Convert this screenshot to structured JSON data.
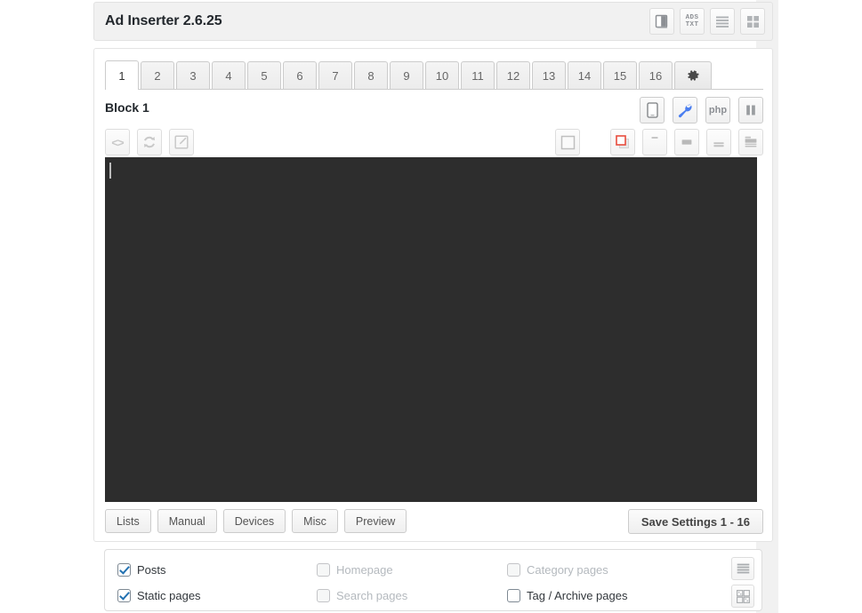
{
  "header": {
    "title": "Ad Inserter 2.6.25",
    "icons": [
      {
        "name": "book-icon",
        "label": "Documentation"
      },
      {
        "name": "ads-txt-icon",
        "label": "ADS TXT"
      },
      {
        "name": "list-view-icon",
        "label": "List"
      },
      {
        "name": "grid-view-icon",
        "label": "Grid"
      }
    ],
    "ads_txt_line1": "ADS",
    "ads_txt_line2": "TXT"
  },
  "tabs": {
    "items": [
      "1",
      "2",
      "3",
      "4",
      "5",
      "6",
      "7",
      "8",
      "9",
      "10",
      "11",
      "12",
      "13",
      "14",
      "15",
      "16"
    ],
    "active_index": 0,
    "settings_tab": {
      "name": "gear-icon",
      "label": "⚙"
    }
  },
  "block": {
    "title": "Block 1",
    "right_icons": [
      {
        "name": "device-icon",
        "label": "Device detection"
      },
      {
        "name": "wrench-icon",
        "label": "Block settings"
      },
      {
        "name": "php-icon",
        "label": "php"
      },
      {
        "name": "pause-icon",
        "label": "Pause"
      }
    ]
  },
  "toolbar": {
    "left_icons": [
      {
        "name": "code-icon",
        "label": "<>"
      },
      {
        "name": "refresh-icon",
        "label": "Reload"
      },
      {
        "name": "edit-icon",
        "label": "Edit"
      }
    ],
    "right_icons": [
      {
        "name": "no-wrapping-icon",
        "label": "No wrapping"
      },
      {
        "name": "clearfix-icon",
        "label": "Clearfix",
        "active": true
      },
      {
        "name": "align-top-icon",
        "label": "Align top"
      },
      {
        "name": "align-center-icon",
        "label": "Align center"
      },
      {
        "name": "align-bottom-icon",
        "label": "Align bottom"
      },
      {
        "name": "align-left-icon",
        "label": "Float left"
      }
    ]
  },
  "editor": {
    "value": "",
    "placeholder": ""
  },
  "buttons": {
    "tabs": [
      "Lists",
      "Manual",
      "Devices",
      "Misc",
      "Preview"
    ],
    "save": "Save Settings 1 - 16"
  },
  "display_options": {
    "items": [
      {
        "label": "Posts",
        "checked": true,
        "disabled": false
      },
      {
        "label": "Homepage",
        "checked": false,
        "disabled": true
      },
      {
        "label": "Category pages",
        "checked": false,
        "disabled": true
      },
      {
        "label": "Static pages",
        "checked": true,
        "disabled": false
      },
      {
        "label": "Search pages",
        "checked": false,
        "disabled": true
      },
      {
        "label": "Tag / Archive pages",
        "checked": false,
        "disabled": false
      }
    ],
    "side_icons": [
      {
        "name": "list-settings-icon",
        "label": "List view"
      },
      {
        "name": "grid-settings-icon",
        "label": "Grid view"
      }
    ]
  },
  "colors": {
    "accent_blue": "#2271b1",
    "wrench_blue": "#4a7ef0",
    "clearfix_red": "#e84c3d",
    "editor_bg": "#2d2d2d",
    "panel_bg": "#f1f1f1"
  }
}
